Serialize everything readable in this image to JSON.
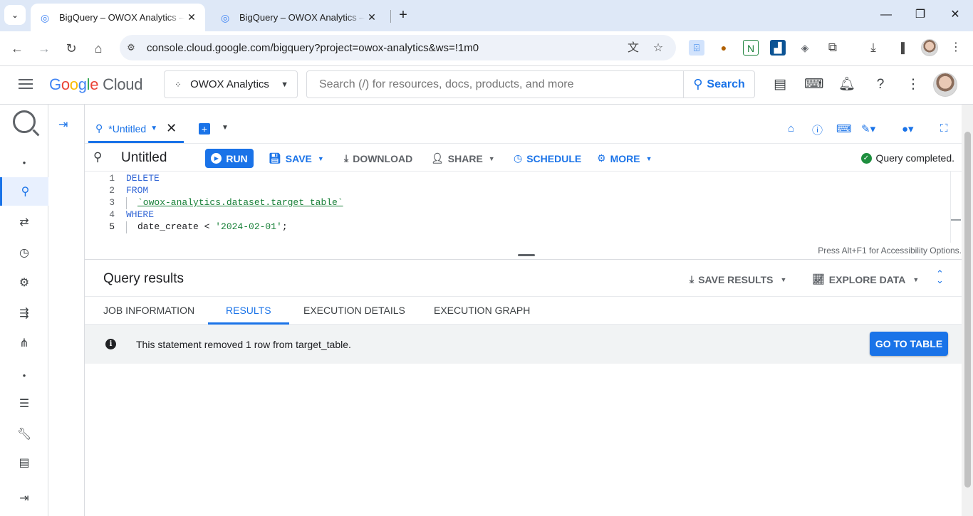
{
  "browser": {
    "tabs": [
      {
        "title": "BigQuery – OWOX Analytics – Goo",
        "active": true
      },
      {
        "title": "BigQuery – OWOX Analytics – Goo",
        "active": false
      }
    ],
    "url": "console.cloud.google.com/bigquery?project=owox-analytics&ws=!1m0",
    "window_controls": {
      "minimize": "—",
      "restore": "❐",
      "close": "✕"
    }
  },
  "gcp_header": {
    "logo_google": [
      "G",
      "o",
      "o",
      "g",
      "l",
      "e"
    ],
    "logo_cloud": "Cloud",
    "project": "OWOX Analytics",
    "search_placeholder": "Search (/) for resources, docs, products, and more",
    "search_button": "Search"
  },
  "rail": {
    "items": [
      "search-icon",
      "transfer-icon",
      "history-icon",
      "scheduled-icon",
      "pipeline-icon",
      "dataform-icon",
      "dot",
      "list-icon",
      "wrench-icon",
      "notes-icon",
      "expand-icon"
    ]
  },
  "editor_tab": {
    "label": "*Untitled"
  },
  "query": {
    "title": "Untitled",
    "run": "RUN",
    "save": "SAVE",
    "download": "DOWNLOAD",
    "share": "SHARE",
    "schedule": "SCHEDULE",
    "more": "MORE",
    "status": "Query completed."
  },
  "code_lines": [
    {
      "n": "1",
      "text": "DELETE"
    },
    {
      "n": "2",
      "text": "FROM"
    },
    {
      "n": "3",
      "text": "`owox-analytics.dataset.target_table`"
    },
    {
      "n": "4",
      "text": "WHERE"
    },
    {
      "n": "5",
      "text_a": "date_create < ",
      "text_b": "'2024-02-01'",
      "text_c": ";"
    }
  ],
  "accessibility_hint": "Press Alt+F1 for Accessibility Options.",
  "results": {
    "title": "Query results",
    "save_results": "SAVE RESULTS",
    "explore_data": "EXPLORE DATA",
    "tabs": [
      "JOB INFORMATION",
      "RESULTS",
      "EXECUTION DETAILS",
      "EXECUTION GRAPH"
    ],
    "active_tab": "RESULTS",
    "message": "This statement removed 1 row from target_table.",
    "go_to_table": "GO TO TABLE"
  },
  "colors": {
    "accent": "#1a73e8",
    "success": "#1e8e3e",
    "tabstrip": "#dee8f7"
  }
}
